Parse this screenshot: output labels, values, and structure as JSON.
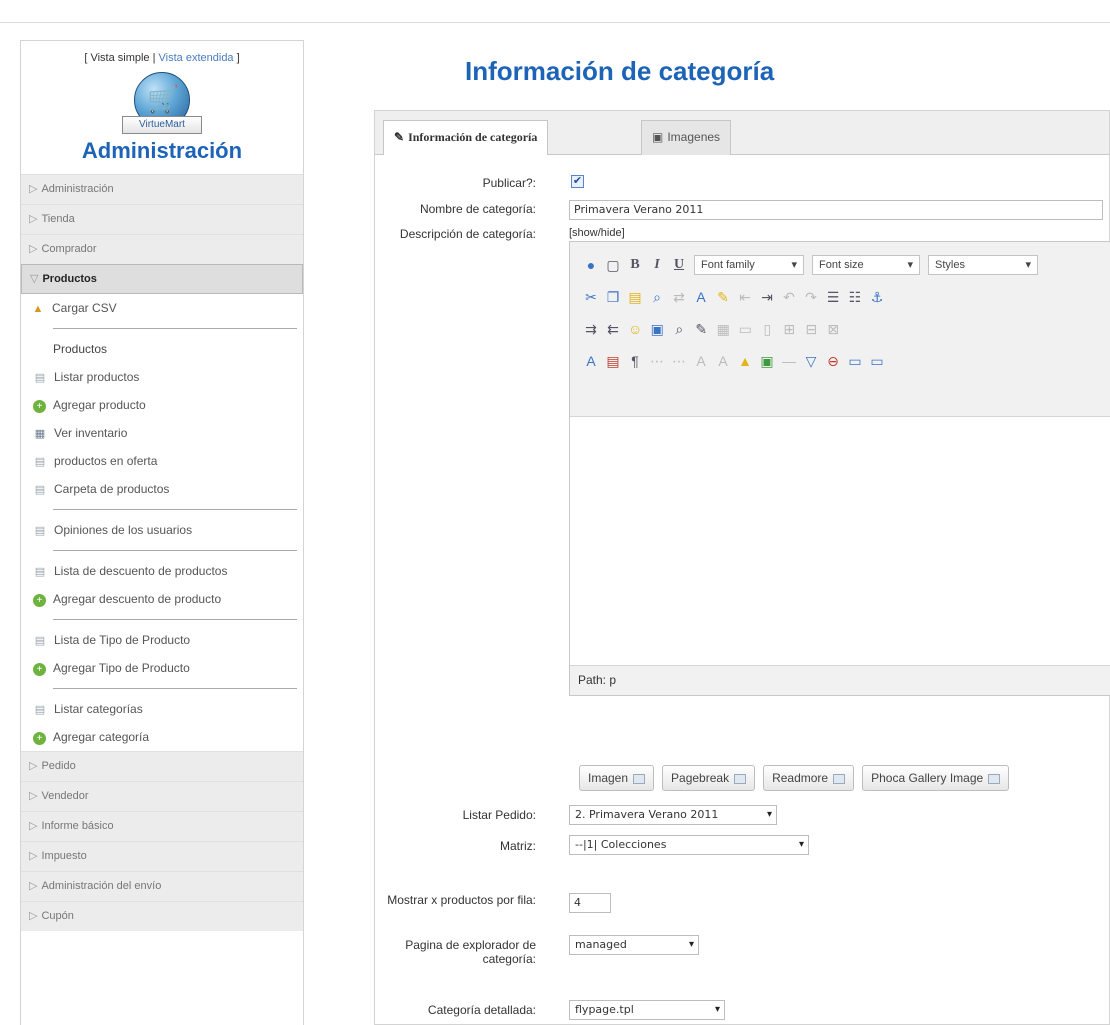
{
  "sidebar": {
    "views": {
      "open": "[ ",
      "simple": "Vista simple",
      "divider": " | ",
      "extended": "Vista extendida",
      "close": " ]"
    },
    "logo_text": "VirtueMart",
    "title": "Administración",
    "sections_top": [
      "Administración",
      "Tienda",
      "Comprador"
    ],
    "active_section": "Productos",
    "csv_item": "Cargar CSV",
    "products_heading": "Productos",
    "product_items": [
      "Listar productos",
      "Agregar producto",
      "Ver inventario",
      "productos en oferta",
      "Carpeta de productos"
    ],
    "reviews_item": "Opiniones de los usuarios",
    "discount_items": [
      "Lista de descuento de productos",
      "Agregar descuento de producto"
    ],
    "type_items": [
      "Lista de Tipo de Producto",
      "Agregar Tipo de Producto"
    ],
    "category_items": [
      "Listar categorías",
      "Agregar categoría"
    ],
    "sections_bottom": [
      "Pedido",
      "Vendedor",
      "Informe básico",
      "Impuesto",
      "Administración del envío",
      "Cupón"
    ]
  },
  "page_title": "Información de categoría",
  "tabs": [
    "Información de categoría",
    "Imagenes"
  ],
  "form": {
    "publish_label": "Publicar?:",
    "name_label": "Nombre de categoría:",
    "name_value": "Primavera Verano 2011",
    "desc_label": "Descripción de categoría:",
    "showhide": "[show/hide]",
    "font_family": "Font family",
    "font_size": "Font size",
    "styles": "Styles",
    "path_text": "Path: p",
    "order_label": "Listar Pedido:",
    "order_value": "2. Primavera Verano 2011",
    "parent_label": "Matriz:",
    "parent_value": "--|1| Colecciones",
    "perrow_label": "Mostrar x productos por fila:",
    "perrow_value": "4",
    "browse_label": "Pagina de explorador de categoría:",
    "browse_value": "managed",
    "flypage_label": "Categoría detallada:",
    "flypage_value": "flypage.tpl"
  },
  "editor_buttons": [
    "Imagen",
    "Pagebreak",
    "Readmore",
    "Phoca Gallery Image"
  ],
  "colors": {
    "accent": "#1d63b6",
    "link": "#4a7bc0",
    "add_green": "#6eb33d"
  },
  "icons": [
    "cart-icon",
    "plus-icon",
    "document-icon",
    "box-icon",
    "arrow-right-icon",
    "arrow-down-icon",
    "checkbox-checked-icon",
    "dropdown-arrow-icon"
  ]
}
